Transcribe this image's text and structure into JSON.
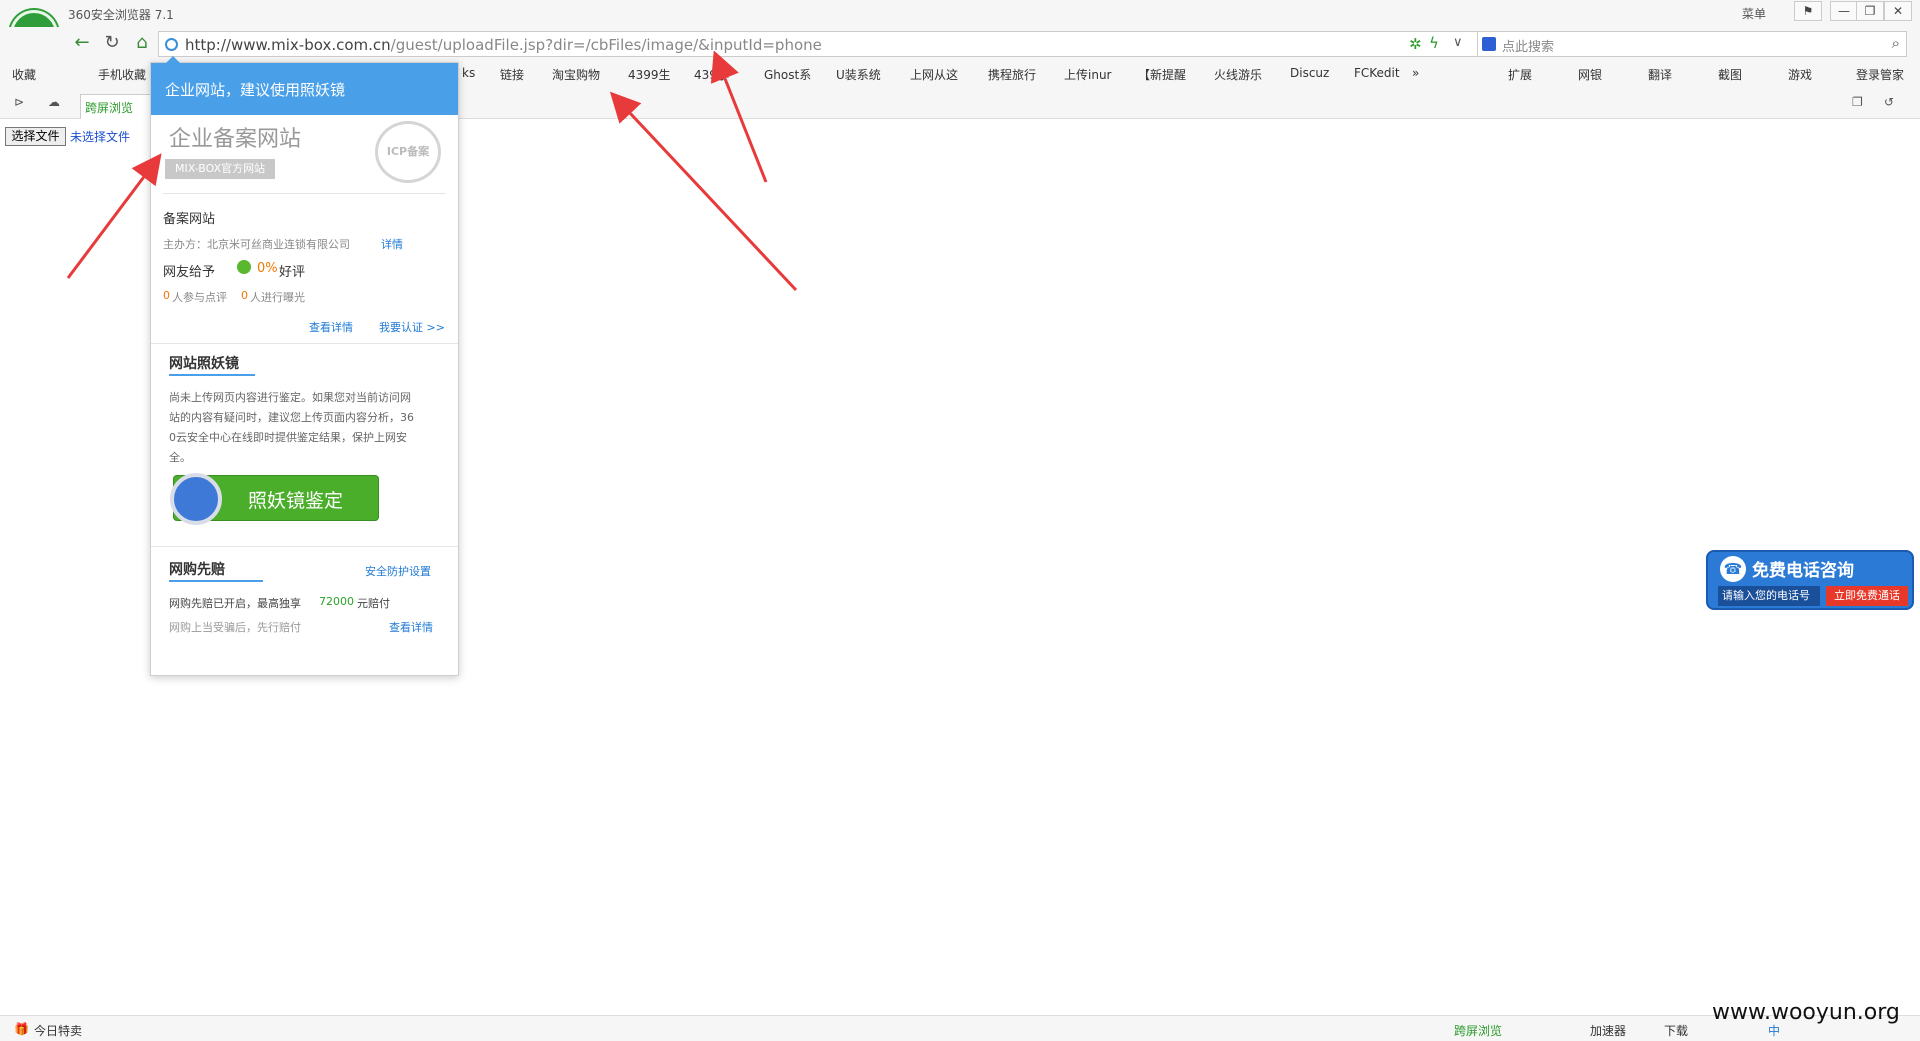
{
  "titlebar": {
    "title": "360安全浏览器 7.1",
    "menu": "菜单",
    "buttons": [
      "⚑",
      "—",
      "❐",
      "✕"
    ]
  },
  "address": {
    "host": "http://www.mix-box.com.cn",
    "path": "/guest/uploadFile.jsp?dir=/cbFiles/image/&inputId=phone",
    "search_placeholder": "点此搜索"
  },
  "bookmarks": {
    "left": [
      "收藏",
      "手机收藏",
      "ks",
      "链接",
      "淘宝购物",
      "4399生",
      "439小",
      "Ghost系",
      "U装系统",
      "上网从这",
      "携程旅行",
      "上传inur",
      "【新提醒",
      "火线游乐",
      "Discuz",
      "FCKedit",
      "»"
    ],
    "right": [
      "扩展",
      "网银",
      "翻译",
      "截图",
      "游戏",
      "登录管家"
    ]
  },
  "tab": {
    "label": "跨屏浏览"
  },
  "page": {
    "file_button": "选择文件",
    "file_status": "未选择文件"
  },
  "popup": {
    "header": "企业网站，建议使用照妖镜",
    "corp_title": "企业备案网站",
    "corp_tag": "MIX-BOX官方网站",
    "seal": "ICP备案",
    "record_label": "备案网站",
    "sponsor": "主办方：北京米可丝商业连锁有限公司",
    "detail_link": "详情",
    "rating_prefix": "网友给予",
    "rating_value": "0%",
    "rating_suffix": "好评",
    "count1": "0",
    "count1_label": "人参与点评",
    "count2": "0",
    "count2_label": "人进行曝光",
    "view_detail": "查看详情",
    "certify": "我要认证 >>",
    "section1_title": "网站照妖镜",
    "section1_line1": "尚未上传网页内容进行鉴定。如果您对当前访问网",
    "section1_line2": "站的内容有疑问时，建议您上传页面内容分析，36",
    "section1_line3": "0云安全中心在线即时提供鉴定结果，保护上网安",
    "section1_line4": "全。",
    "zyj_button": "照妖镜鉴定",
    "section2_title": "网购先赔",
    "security_settings": "安全防护设置",
    "shop_line1_pre": "网购先赔已开启，最高独享",
    "shop_amount": "72000",
    "shop_line1_post": "元赔付",
    "shop_line2": "网购上当受骗后，先行赔付",
    "shop_detail": "查看详情"
  },
  "phone_widget": {
    "title": "免费电话咨询",
    "input_placeholder": "请输入您的电话号",
    "call_button": "立即免费通话"
  },
  "statusbar": {
    "left": "今日特卖",
    "items": [
      "跨屏浏览",
      "加速器",
      "下载"
    ],
    "ime": "中"
  },
  "watermark": "www.wooyun.org",
  "colors": {
    "accent": "#4aa0e8",
    "green": "#2ca32c",
    "orange": "#f07800",
    "arrow": "#e83a3a"
  }
}
